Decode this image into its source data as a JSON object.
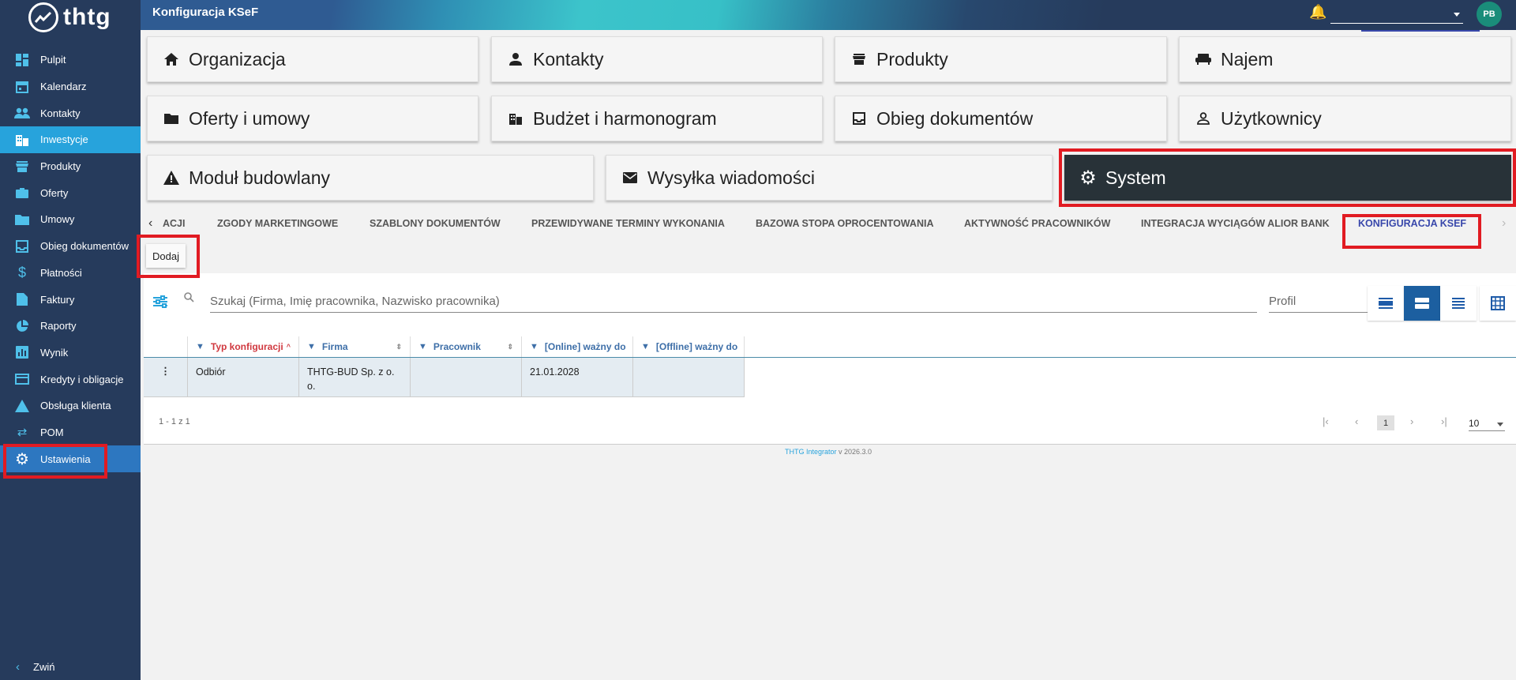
{
  "app": {
    "logo_text": "thtg",
    "page_title": "Konfiguracja KSeF",
    "avatar_initials": "PB"
  },
  "sidebar": {
    "items": [
      {
        "label": "Pulpit",
        "icon": "dashboard-icon"
      },
      {
        "label": "Kalendarz",
        "icon": "calendar-icon"
      },
      {
        "label": "Kontakty",
        "icon": "people-icon"
      },
      {
        "label": "Inwestycje",
        "icon": "building-icon"
      },
      {
        "label": "Produkty",
        "icon": "store-icon"
      },
      {
        "label": "Oferty",
        "icon": "briefcase-icon"
      },
      {
        "label": "Umowy",
        "icon": "folder-icon"
      },
      {
        "label": "Obieg dokumentów",
        "icon": "inbox-icon"
      },
      {
        "label": "Płatności",
        "icon": "dollar-icon"
      },
      {
        "label": "Faktury",
        "icon": "document-icon"
      },
      {
        "label": "Raporty",
        "icon": "pie-chart-icon"
      },
      {
        "label": "Wynik",
        "icon": "bar-chart-icon"
      },
      {
        "label": "Kredyty i obligacje",
        "icon": "credit-card-icon"
      },
      {
        "label": "Obsługa klienta",
        "icon": "warning-icon"
      },
      {
        "label": "POM",
        "icon": "swap-icon"
      },
      {
        "label": "Ustawienia",
        "icon": "gear-icon"
      }
    ],
    "collapse_label": "Zwiń"
  },
  "modules": {
    "organizacja": "Organizacja",
    "kontakty": "Kontakty",
    "produkty": "Produkty",
    "najem": "Najem",
    "oferty": "Oferty i umowy",
    "budzet": "Budżet i harmonogram",
    "obieg": "Obieg dokumentów",
    "uzytkownicy": "Użytkownicy",
    "budowlany": "Moduł budowlany",
    "wysylka": "Wysyłka wiadomości",
    "system": "System"
  },
  "tabs": {
    "items": [
      "ACJI",
      "ZGODY MARKETINGOWE",
      "SZABLONY DOKUMENTÓW",
      "PRZEWIDYWANE TERMINY WYKONANIA",
      "BAZOWA STOPA OPROCENTOWANIA",
      "AKTYWNOŚĆ PRACOWNIKÓW",
      "INTEGRACJA WYCIĄGÓW ALIOR BANK",
      "KONFIGURACJA KSEF"
    ],
    "active": "KONFIGURACJA KSEF"
  },
  "actions": {
    "add_label": "Dodaj"
  },
  "search": {
    "placeholder": "Szukaj (Firma, Imię pracownika, Nazwisko pracownika)"
  },
  "profile": {
    "label": "Profil"
  },
  "grid": {
    "columns": [
      "Typ konfiguracji",
      "Firma",
      "Pracownik",
      "[Online] ważny do",
      "[Offline] ważny do"
    ],
    "rows": [
      [
        "Odbiór",
        "THTG-BUD Sp. z o. o.",
        "",
        "21.01.2028",
        ""
      ]
    ]
  },
  "pagination": {
    "info": "1 - 1 z 1",
    "current_page": "1",
    "page_size": "10"
  },
  "footer": {
    "app_name": "THTG Integrator",
    "version": "v 2026.3.0"
  },
  "colors": {
    "sidebar_bg": "#263b5c",
    "accent": "#27a3dc",
    "active_tab": "#3948ab",
    "highlight": "#e11b22"
  }
}
